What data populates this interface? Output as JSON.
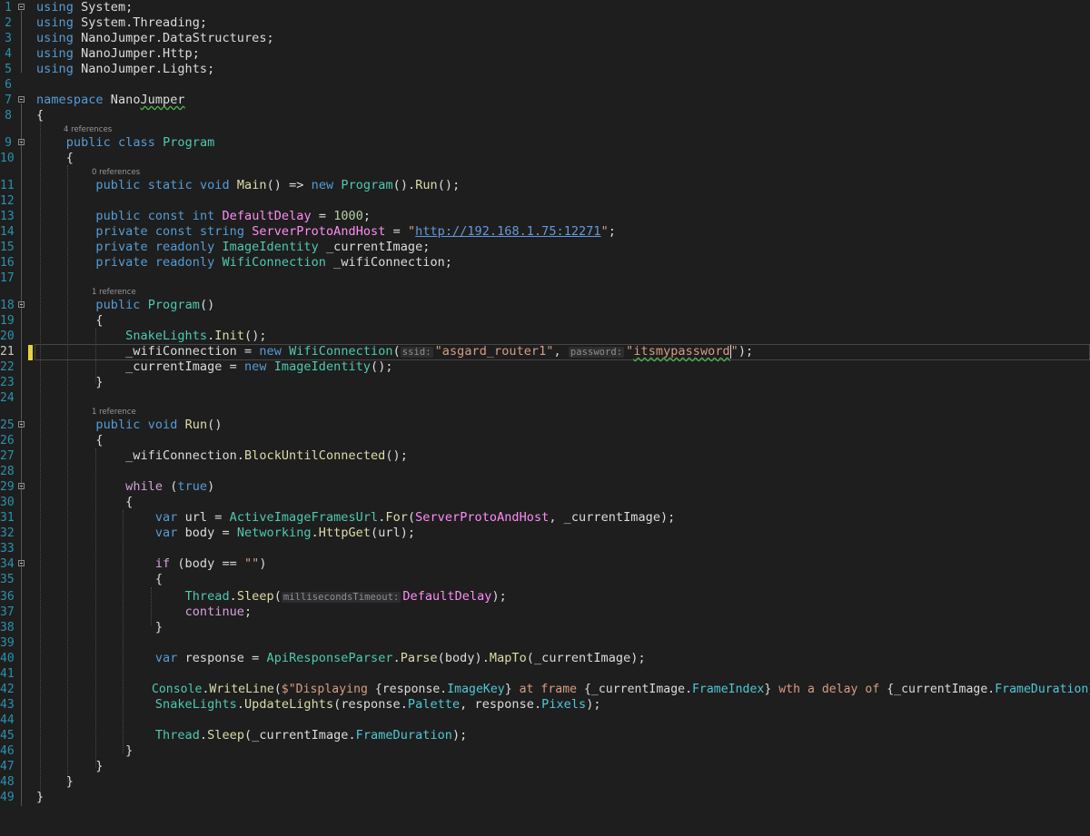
{
  "editor": {
    "language": "C#",
    "active_line": "21",
    "line_numbers": [
      "1",
      "2",
      "3",
      "4",
      "5",
      "6",
      "7",
      "8",
      "9",
      "10",
      "11",
      "12",
      "13",
      "14",
      "15",
      "16",
      "17",
      "18",
      "19",
      "20",
      "21",
      "22",
      "23",
      "24",
      "25",
      "26",
      "27",
      "28",
      "29",
      "30",
      "31",
      "32",
      "33",
      "34",
      "35",
      "36",
      "37",
      "38",
      "39",
      "40",
      "41",
      "42",
      "43",
      "44",
      "45",
      "46",
      "47",
      "48",
      "49"
    ],
    "code_lens": {
      "program_class": "4 references",
      "main_method": "0 references",
      "ctor_method": "1 reference",
      "run_method": "1 reference"
    },
    "inlay_hints": {
      "ssid": "ssid:",
      "password": "password:",
      "timeout": "millisecondsTimeout:"
    },
    "colors": {
      "background": "#1e1e1e",
      "keyword": "#569cd6",
      "control_keyword": "#d8a0df",
      "class": "#4ec9b0",
      "method": "#dcdcaa",
      "constant": "#ff8cf5",
      "string": "#d69d85",
      "number": "#b5cea8",
      "line_number": "#2b91af",
      "change_marker": "#e8d33f"
    }
  }
}
